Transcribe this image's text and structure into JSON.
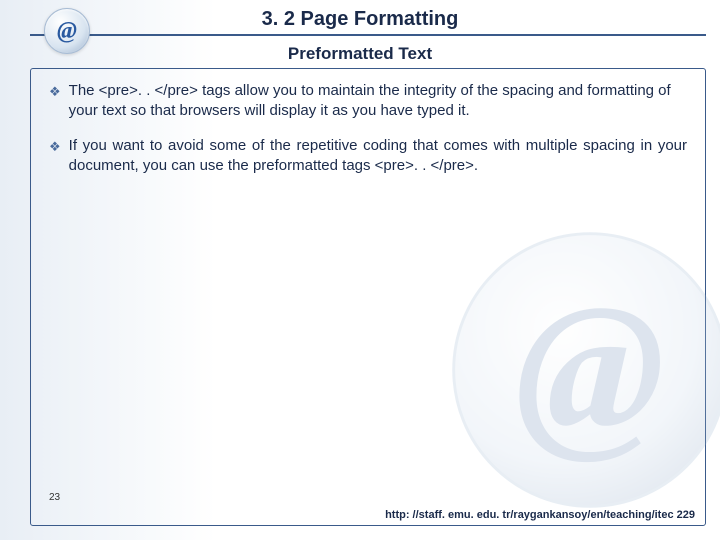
{
  "title": "3. 2 Page Formatting",
  "subtitle": "Preformatted Text",
  "at_glyph": "@",
  "bullet_glyph": "❖",
  "bullets": [
    "The <pre>. . </pre> tags allow you to maintain the integrity of the spacing and formatting of your text so that browsers will display it as you have typed it.",
    "If you want to avoid some of the repetitive coding that comes with multiple spacing in your document, you can use the preformatted tags <pre>. . </pre>."
  ],
  "page_number": "23",
  "footer_url": "http: //staff. emu. edu. tr/raygankansoy/en/teaching/itec 229"
}
